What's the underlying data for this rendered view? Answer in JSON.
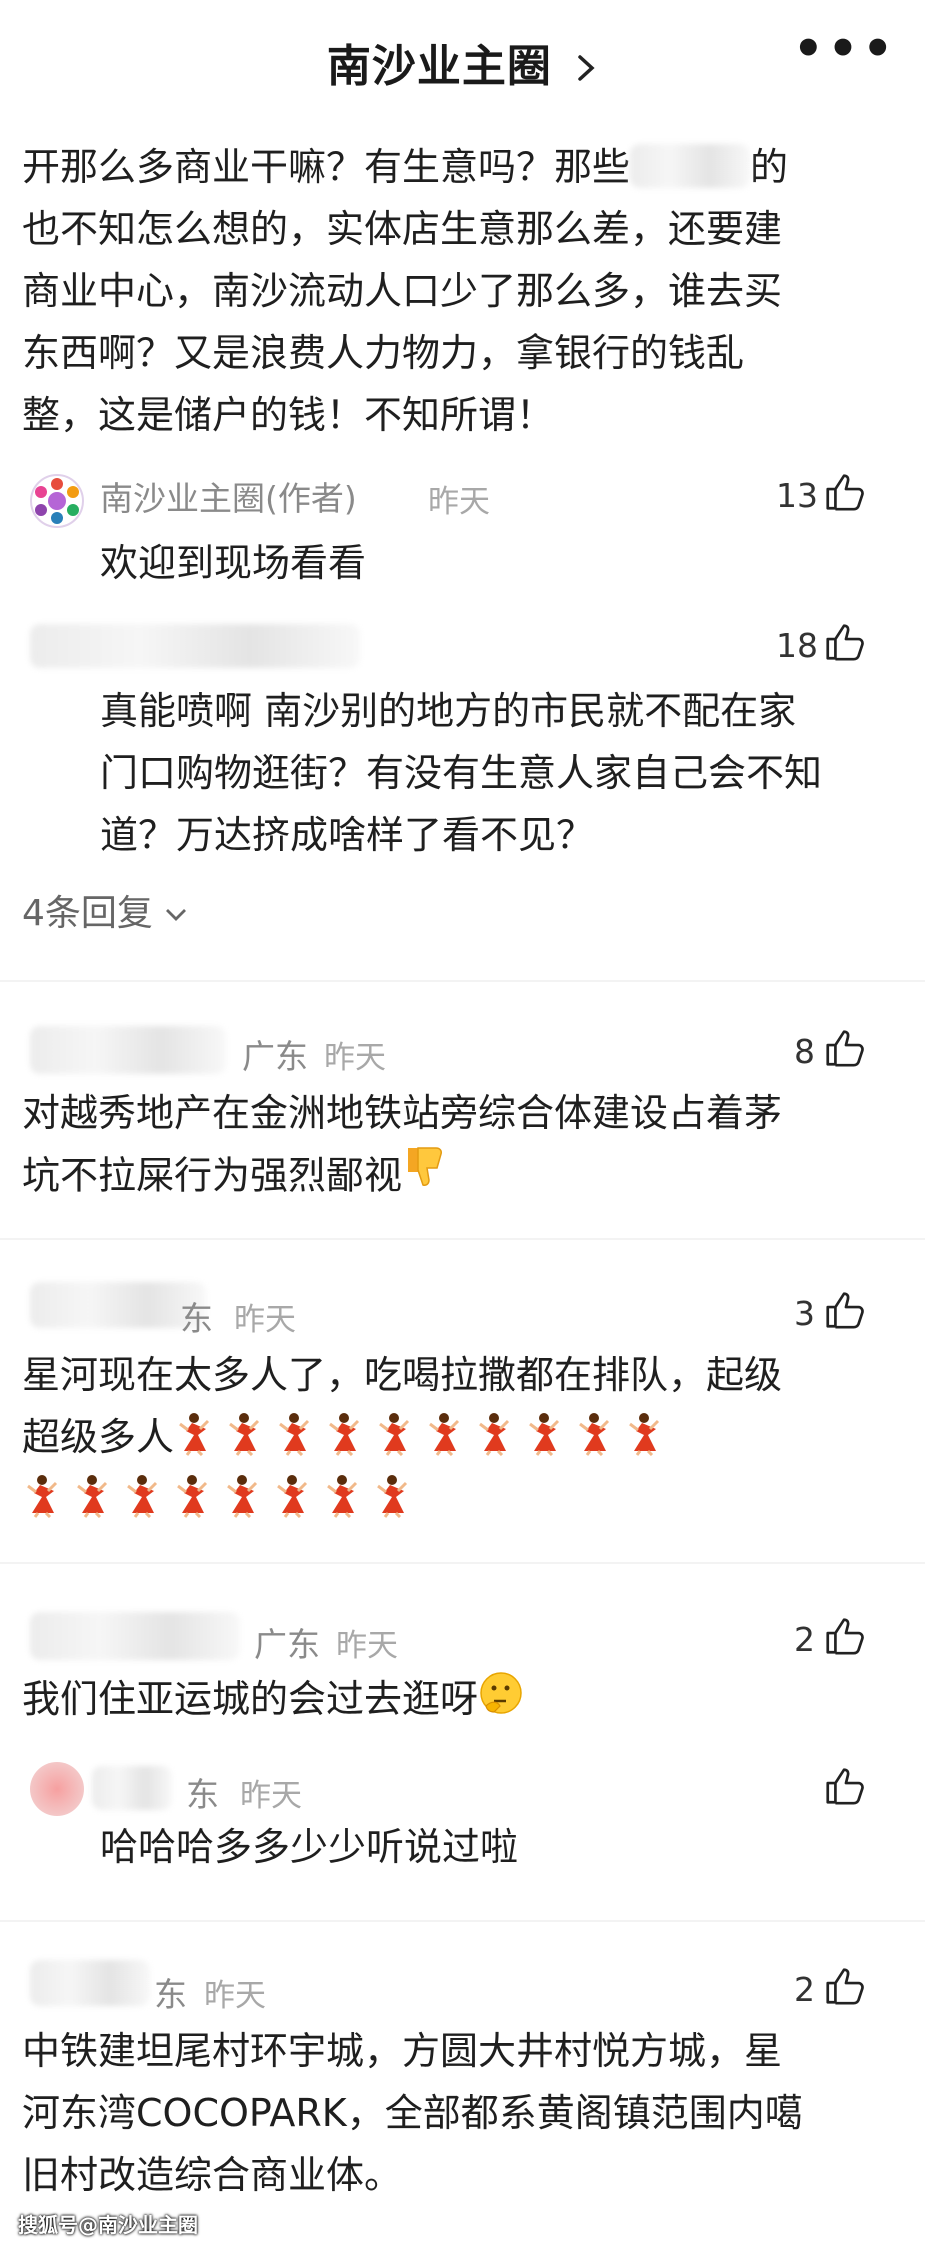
{
  "header": {
    "title": "南沙业主圈",
    "chevron": "chevron-right-icon",
    "more": "•••"
  },
  "post": {
    "text_line1": "开那么多商业干嘛？有生意吗？那些",
    "text_line1_end": "的",
    "text_line2": "也不知怎么想的，实体店生意那么差，还要建",
    "text_line3": "商业中心，南沙流动人口少了那么多，谁去买",
    "text_line4": "东西啊？又是浪费人力物力，拿银行的钱乱",
    "text_line5": "整，这是储户的钱！不知所谓！"
  },
  "replies": [
    {
      "name": "南沙业主圈(作者)",
      "time": "昨天",
      "likes": "13",
      "text": "欢迎到现场看看"
    },
    {
      "likes": "18",
      "text_line1": "真能喷啊 南沙别的地方的市民就不配在家",
      "text_line2": "门口购物逛街？有没有生意人家自己会不知",
      "text_line3": "道？万达挤成啥样了看不见？"
    }
  ],
  "more_replies": "4条回复",
  "comments": [
    {
      "region": "广东",
      "time": "昨天",
      "likes": "8",
      "text_line1": "对越秀地产在金洲地铁站旁综合体建设占着茅",
      "text_line2": "坑不拉屎行为强烈鄙视"
    },
    {
      "region_partial": "东",
      "time": "昨天",
      "likes": "3",
      "text_line1": "星河现在太多人了，吃喝拉撒都在排队，起级",
      "text_line2": "超级多人"
    },
    {
      "region": "广东",
      "time": "昨天",
      "likes": "2",
      "text": "我们住亚运城的会过去逛呀"
    },
    {
      "region_partial": "东",
      "time": "昨天",
      "text": "哈哈哈多多少少听说过啦"
    },
    {
      "region_partial": "东",
      "time": "昨天",
      "likes": "2",
      "text_line1": "中铁建坦尾村环宇城，方圆大井村悦方城，星",
      "text_line2": "河东湾COCOPARK，全部都系黄阁镇范围内噶",
      "text_line3": "旧村改造综合商业体。"
    }
  ],
  "watermark": "搜狐号@南沙业主圈",
  "icons": {
    "thumb": "thumbs-up-icon",
    "thumbdown": "thumbs-down-emoji",
    "thinking": "thinking-emoji",
    "dancer": "dancer-emoji"
  },
  "colors": {
    "muted": "#8a8a8a",
    "text": "#1f1f1f",
    "accent": "#ff6a00"
  }
}
